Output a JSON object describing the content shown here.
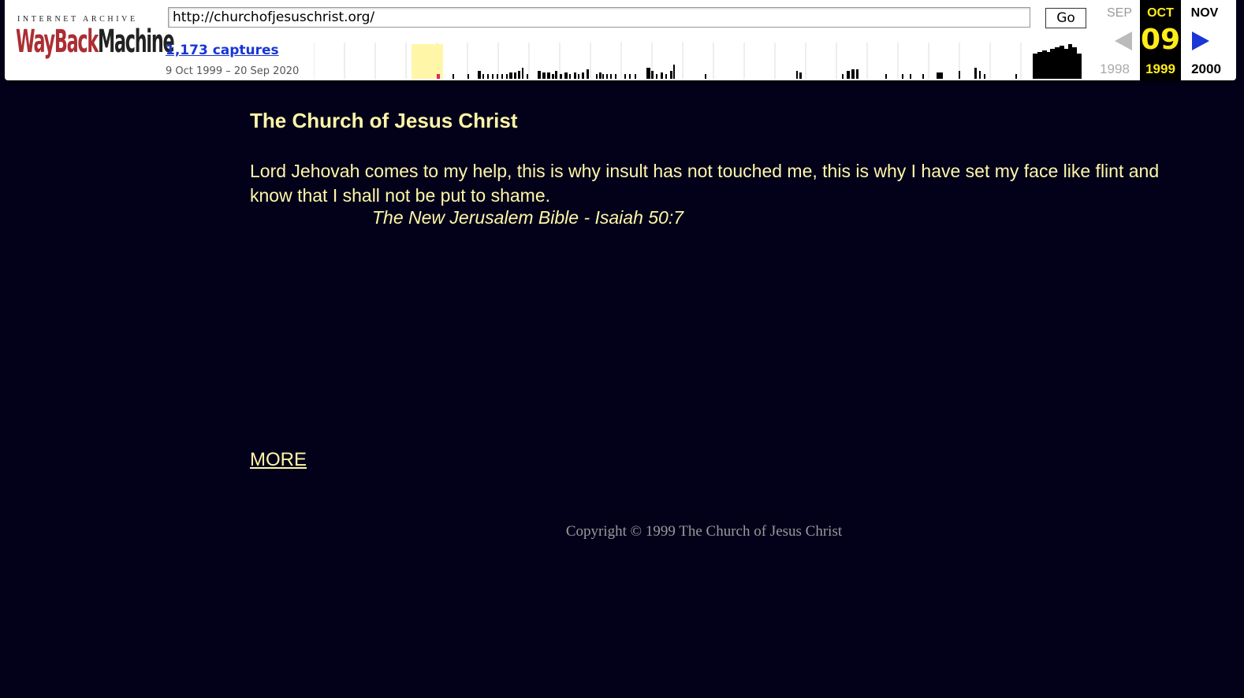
{
  "toolbar": {
    "logo_top": "INTERNET ARCHIVE",
    "logo_word1": "WayBack",
    "logo_word2": "Machine",
    "url": "http://churchofjesuschrist.org/",
    "go_label": "Go",
    "captures_label": "1,173 captures",
    "capture_range": "9 Oct 1999 – 20 Sep 2020",
    "calendar": {
      "prev_month": "SEP",
      "current_month": "OCT",
      "next_month": "NOV",
      "current_day": "09",
      "prev_year": "1998",
      "current_year": "1999",
      "next_year": "2000"
    },
    "icons": {
      "prev": "left-arrow-icon",
      "next": "right-arrow-icon"
    }
  },
  "page": {
    "heading": "The Church of Jesus Christ",
    "quote": "Lord Jehovah comes to my help, this is why insult has not touched me, this is why I have set my face like flint and know that I shall not be put to shame.",
    "citation": "The New Jerusalem Bible - Isaiah 50:7",
    "more_link": "MORE",
    "copyright": "Copyright © 1999 The Church of Jesus Christ"
  },
  "colors": {
    "page_bg": "#03001a",
    "text_yellow": "#fff7a8",
    "link_blue": "#1a36d6",
    "logo_red": "#ab2e33",
    "highlight_yellow": "#ffec1a"
  }
}
